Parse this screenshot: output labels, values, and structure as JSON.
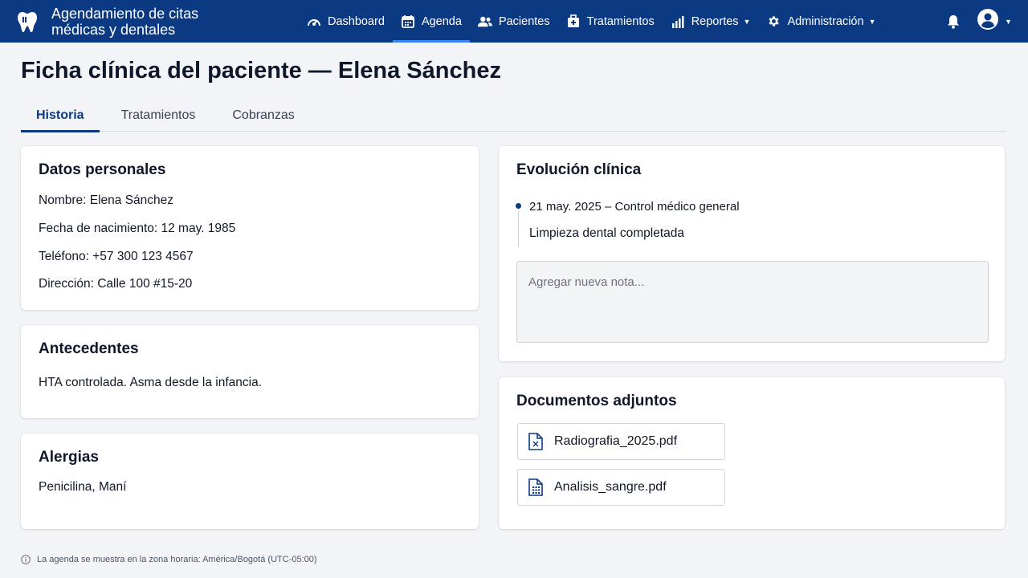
{
  "app": {
    "title": "Agendamiento de citas médicas y dentales"
  },
  "nav": {
    "items": [
      {
        "label": "Dashboard",
        "icon": "dashboard-gauge-icon"
      },
      {
        "label": "Agenda",
        "icon": "calendar-icon"
      },
      {
        "label": "Pacientes",
        "icon": "users-icon"
      },
      {
        "label": "Tratamientos",
        "icon": "medkit-icon"
      },
      {
        "label": "Reportes",
        "icon": "bar-chart-icon"
      },
      {
        "label": "Administración",
        "icon": "gear-icon"
      }
    ],
    "active": "Agenda"
  },
  "page": {
    "title": "Ficha clínica del paciente — Elena Sánchez"
  },
  "tabs": [
    {
      "label": "Historia",
      "active": true
    },
    {
      "label": "Tratamientos",
      "active": false
    },
    {
      "label": "Cobranzas",
      "active": false
    }
  ],
  "personal": {
    "heading": "Datos personales",
    "nombre": "Nombre: Elena Sánchez",
    "nacimiento": "Fecha de nacimiento: 12 may. 1985",
    "telefono": "Teléfono: +57 300 123 4567",
    "direccion": "Dirección: Calle 100 #15-20"
  },
  "antecedentes": {
    "heading": "Antecedentes",
    "text": "HTA controlada. Asma desde la infancia."
  },
  "alergias": {
    "heading": "Alergias",
    "text": "Penicilina, Maní"
  },
  "evolucion": {
    "heading": "Evolución clínica",
    "entry_date": "21 may. 2025 – Control médico general",
    "entry_note": "Limpieza dental completada",
    "note_placeholder": "Agregar nueva nota..."
  },
  "documentos": {
    "heading": "Documentos adjuntos",
    "files": [
      {
        "name": "Radiografia_2025.pdf",
        "icon": "pdf-file-icon"
      },
      {
        "name": "Analisis_sangre.pdf",
        "icon": "spreadsheet-file-icon"
      }
    ]
  },
  "footer": {
    "timezone_note": "La agenda se muestra en la zona horaria: América/Bogotá (UTC-05:00)"
  },
  "colors": {
    "primary": "#0c3a82",
    "accent": "#3b82f6",
    "background": "#f3f4f7"
  }
}
